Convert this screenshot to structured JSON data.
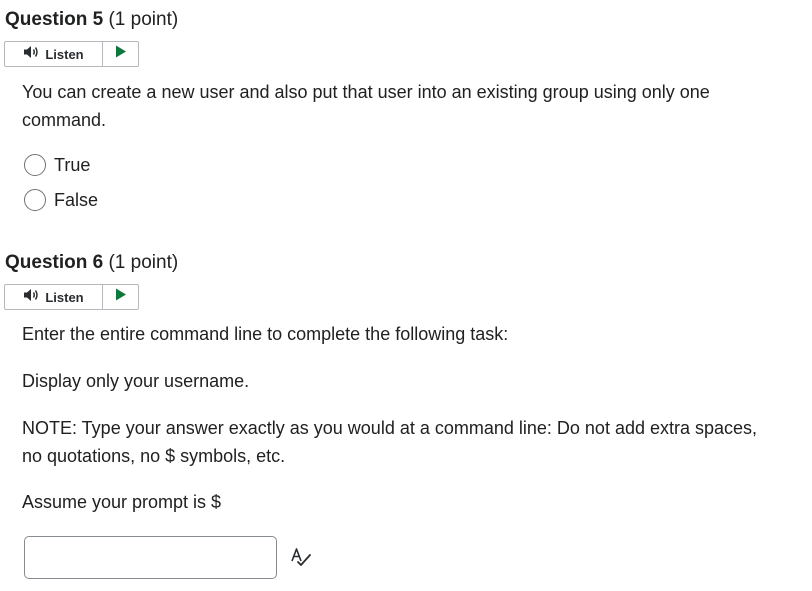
{
  "questions": [
    {
      "number": "Question 5",
      "points": "(1 point)",
      "listen_label": "Listen",
      "prompt": "You can create a new user and also put that user into an existing group using only one command.",
      "options": [
        "True",
        "False"
      ]
    },
    {
      "number": "Question 6",
      "points": "(1 point)",
      "listen_label": "Listen",
      "paragraphs": [
        "Enter the entire command line to complete the following task:",
        "Display only your username.",
        "NOTE: Type your answer exactly as you would at a command line:  Do not add extra spaces, no quotations, no $ symbols, etc.",
        "Assume your prompt is $"
      ],
      "answer_value": ""
    }
  ],
  "icons": {
    "listen": "speaker-icon",
    "play": "play-icon",
    "spellcheck": "spellcheck-icon"
  },
  "colors": {
    "play_green": "#0a7a3a",
    "text": "#202122",
    "border": "#b5b9bd"
  }
}
